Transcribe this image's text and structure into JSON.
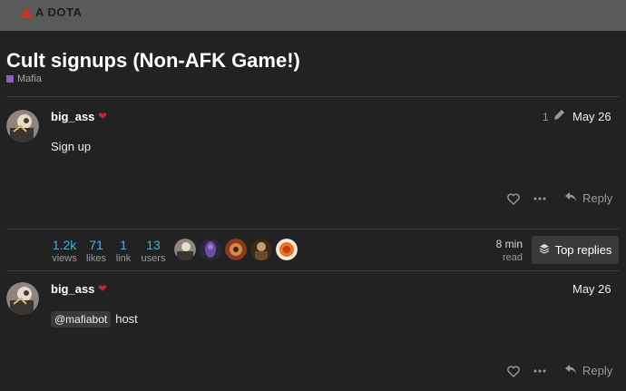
{
  "site": {
    "logo_text": "A DOTA"
  },
  "topic": {
    "title": "Cult signups (Non-AFK Game!)",
    "category": "Mafia",
    "category_color": "#8a63b8"
  },
  "posts": [
    {
      "username": "big_ass",
      "badge_icon": "heart-icon",
      "edit_count": "1",
      "date": "May 26",
      "body": "Sign up",
      "reply_label": "Reply"
    },
    {
      "username": "big_ass",
      "badge_icon": "heart-icon",
      "date": "May 26",
      "mention": "@mafiabot",
      "body": "host",
      "reply_label": "Reply"
    }
  ],
  "topic_map": {
    "stats": [
      {
        "value": "1.2k",
        "label": "views"
      },
      {
        "value": "71",
        "label": "likes"
      },
      {
        "value": "1",
        "label": "link"
      },
      {
        "value": "13",
        "label": "users"
      }
    ],
    "read_time": {
      "value": "8 min",
      "label": "read"
    },
    "top_replies_label": "Top replies"
  },
  "colors": {
    "accent": "#3ab4e8",
    "background": "#222222",
    "header": "#5a5a5a",
    "heart": "#c0262c"
  }
}
